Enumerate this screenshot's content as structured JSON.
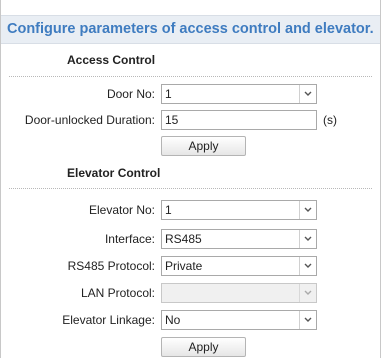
{
  "header": {
    "title": "Configure parameters of access control and elevator."
  },
  "access_control": {
    "section_title": "Access Control",
    "door_no": {
      "label": "Door No:",
      "value": "1"
    },
    "unlock_duration": {
      "label": "Door-unlocked Duration:",
      "value": "15",
      "unit": "(s)"
    },
    "apply_label": "Apply"
  },
  "elevator_control": {
    "section_title": "Elevator Control",
    "elevator_no": {
      "label": "Elevator No:",
      "value": "1"
    },
    "interface": {
      "label": "Interface:",
      "value": "RS485"
    },
    "rs485_protocol": {
      "label": "RS485 Protocol:",
      "value": "Private"
    },
    "lan_protocol": {
      "label": "LAN Protocol:",
      "value": ""
    },
    "elevator_linkage": {
      "label": "Elevator Linkage:",
      "value": "No"
    },
    "apply_label": "Apply"
  }
}
